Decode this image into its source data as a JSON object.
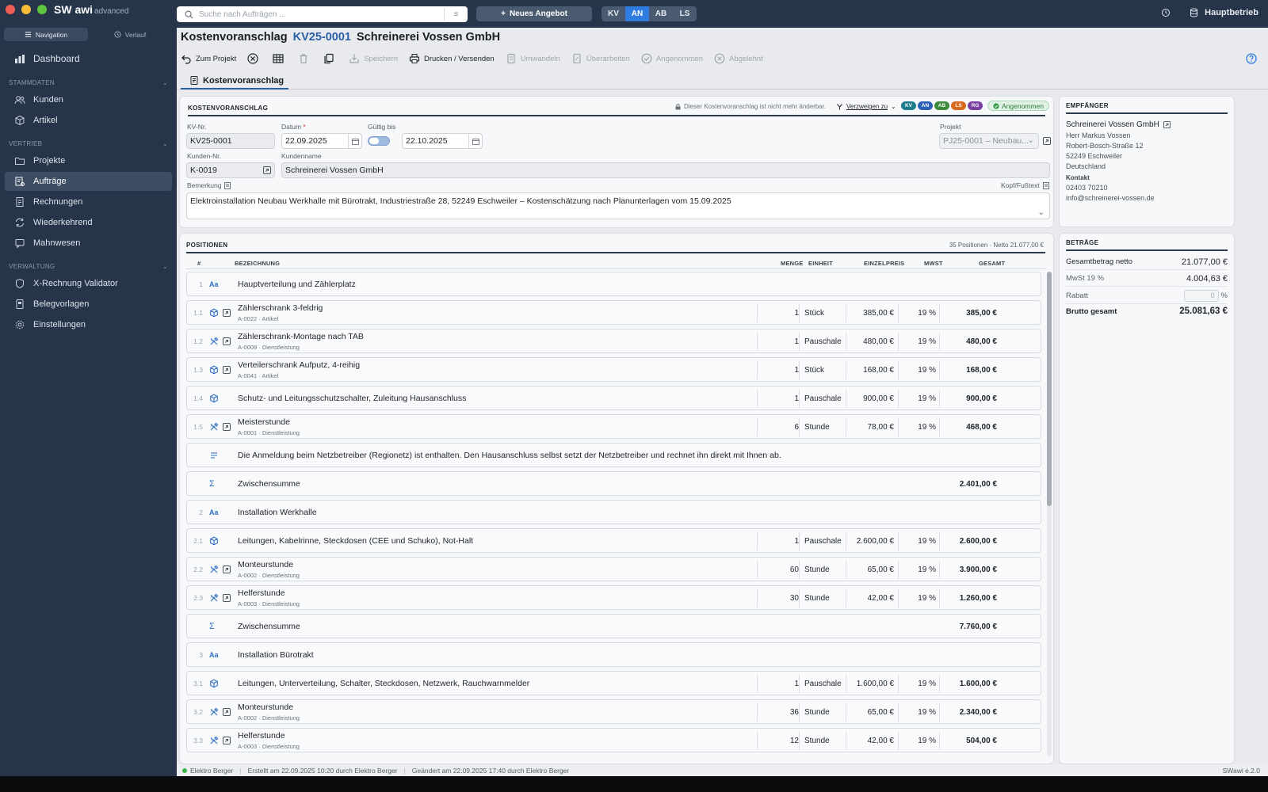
{
  "app": {
    "brand": "SW awi",
    "edition": "advanced",
    "version": "SWawi e.2.0"
  },
  "sidebar": {
    "tabs": [
      {
        "label": "Navigation"
      },
      {
        "label": "Verlauf"
      }
    ],
    "dashboard": "Dashboard",
    "sections": [
      {
        "title": "STAMMDATEN",
        "items": [
          {
            "label": "Kunden",
            "icon": "users-icon"
          },
          {
            "label": "Artikel",
            "icon": "box-icon"
          }
        ]
      },
      {
        "title": "VERTRIEB",
        "items": [
          {
            "label": "Projekte",
            "icon": "folder-icon"
          },
          {
            "label": "Aufträge",
            "icon": "orders-icon"
          },
          {
            "label": "Rechnungen",
            "icon": "invoice-icon"
          },
          {
            "label": "Wiederkehrend",
            "icon": "recurring-icon"
          },
          {
            "label": "Mahnwesen",
            "icon": "dunning-icon"
          }
        ]
      },
      {
        "title": "VERWALTUNG",
        "items": [
          {
            "label": "X-Rechnung Validator",
            "icon": "xinvoice-icon"
          },
          {
            "label": "Belegvorlagen",
            "icon": "template-icon"
          },
          {
            "label": "Einstellungen",
            "icon": "gear-icon"
          }
        ]
      }
    ]
  },
  "topbar": {
    "search_placeholder": "Suche nach Aufträgen ...",
    "new_button": "Neues Angebot",
    "doc_types": [
      "KV",
      "AN",
      "AB",
      "LS"
    ],
    "company": "Hauptbetrieb"
  },
  "header": {
    "title": "Kostenvoranschlag",
    "number": "KV25-0001",
    "customer": "Schreinerei Vossen GmbH"
  },
  "toolbar": {
    "back": "Zum Projekt",
    "save": "Speichern",
    "print": "Drucken / Versenden",
    "convert": "Umwandeln",
    "revise": "Überarbeiten",
    "accepted": "Angenommen",
    "rejected": "Abgelehnt"
  },
  "tab": "Kostenvoranschlag",
  "form": {
    "section": "KOSTENVORANSCHLAG",
    "lock_text": "Dieser Kostenvoranschlag ist nicht mehr änderbar.",
    "branch": "Verzweigen zu",
    "doc_pills": [
      {
        "label": "KV",
        "color": "#1d7c8c"
      },
      {
        "label": "AN",
        "color": "#2c62b4"
      },
      {
        "label": "AB",
        "color": "#3c8a3c"
      },
      {
        "label": "LS",
        "color": "#d9691c"
      },
      {
        "label": "RG",
        "color": "#7a3fa0"
      }
    ],
    "status": "Angenommen",
    "kv_label": "KV-Nr.",
    "kv_value": "KV25-0001",
    "date_label": "Datum",
    "date_value": "22.09.2025",
    "valid_label": "Gültig bis",
    "valid_value": "22.10.2025",
    "project_label": "Projekt",
    "project_value": "PJ25-0001 – Neubau...",
    "cust_no_label": "Kunden-Nr.",
    "cust_no_value": "K-0019",
    "cust_name_label": "Kundenname",
    "cust_name_value": "Schreinerei Vossen GmbH",
    "remark_label": "Bemerkung",
    "header_footer": "Kopf/Fußtext",
    "remark_value": "Elektroinstallation Neubau Werkhalle mit Bürotrakt, Industriestraße 28, 52249 Eschweiler – Kostenschätzung nach Planunterlagen vom 15.09.2025"
  },
  "positions": {
    "section": "POSITIONEN",
    "summary": "35 Positionen · Netto 21.077,00 €",
    "columns": [
      "#",
      "BEZEICHNUNG",
      "MENGE",
      "EINHEIT",
      "EINZELPREIS",
      "MWST",
      "GESAMT"
    ],
    "rows": [
      {
        "no": "1",
        "kind": "heading",
        "title": "Hauptverteilung und Zählerplatz"
      },
      {
        "no": "1.1",
        "kind": "article",
        "title": "Zählerschrank 3-feldrig",
        "sub": "A-0022 · Artikel",
        "qty": "1",
        "unit": "Stück",
        "price": "385,00 €",
        "vat": "19 %",
        "total": "385,00 €"
      },
      {
        "no": "1.2",
        "kind": "service",
        "title": "Zählerschrank-Montage nach TAB",
        "sub": "A-0009 · Dienstleistung",
        "qty": "1",
        "unit": "Pauschale",
        "price": "480,00 €",
        "vat": "19 %",
        "total": "480,00 €"
      },
      {
        "no": "1.3",
        "kind": "article",
        "title": "Verteilerschrank Aufputz, 4-reihig",
        "sub": "A-0041 · Artikel",
        "qty": "1",
        "unit": "Stück",
        "price": "168,00 €",
        "vat": "19 %",
        "total": "168,00 €"
      },
      {
        "no": "1.4",
        "kind": "free",
        "title": "Schutz- und Leitungsschutzschalter, Zuleitung Hausanschluss",
        "qty": "1",
        "unit": "Pauschale",
        "price": "900,00 €",
        "vat": "19 %",
        "total": "900,00 €"
      },
      {
        "no": "1.5",
        "kind": "service",
        "title": "Meisterstunde",
        "sub": "A-0001 · Dienstleistung",
        "qty": "6",
        "unit": "Stunde",
        "price": "78,00 €",
        "vat": "19 %",
        "total": "468,00 €"
      },
      {
        "no": "",
        "kind": "text",
        "title": "Die Anmeldung beim Netzbetreiber (Regionetz) ist enthalten. Den Hausanschluss selbst setzt der Netzbetreiber und rechnet ihn direkt mit Ihnen ab."
      },
      {
        "no": "",
        "kind": "subtotal",
        "title": "Zwischensumme",
        "total": "2.401,00 €"
      },
      {
        "no": "2",
        "kind": "heading",
        "title": "Installation Werkhalle"
      },
      {
        "no": "2.1",
        "kind": "free",
        "title": "Leitungen, Kabelrinne, Steckdosen (CEE und Schuko), Not-Halt",
        "qty": "1",
        "unit": "Pauschale",
        "price": "2.600,00 €",
        "vat": "19 %",
        "total": "2.600,00 €"
      },
      {
        "no": "2.2",
        "kind": "service",
        "title": "Monteurstunde",
        "sub": "A-0002 · Dienstleistung",
        "qty": "60",
        "unit": "Stunde",
        "price": "65,00 €",
        "vat": "19 %",
        "total": "3.900,00 €"
      },
      {
        "no": "2.3",
        "kind": "service",
        "title": "Helferstunde",
        "sub": "A-0003 · Dienstleistung",
        "qty": "30",
        "unit": "Stunde",
        "price": "42,00 €",
        "vat": "19 %",
        "total": "1.260,00 €"
      },
      {
        "no": "",
        "kind": "subtotal",
        "title": "Zwischensumme",
        "total": "7.760,00 €"
      },
      {
        "no": "3",
        "kind": "heading",
        "title": "Installation Bürotrakt"
      },
      {
        "no": "3.1",
        "kind": "free",
        "title": "Leitungen, Unterverteilung, Schalter, Steckdosen, Netzwerk, Rauchwarnmelder",
        "qty": "1",
        "unit": "Pauschale",
        "price": "1.600,00 €",
        "vat": "19 %",
        "total": "1.600,00 €"
      },
      {
        "no": "3.2",
        "kind": "service",
        "title": "Monteurstunde",
        "sub": "A-0002 · Dienstleistung",
        "qty": "36",
        "unit": "Stunde",
        "price": "65,00 €",
        "vat": "19 %",
        "total": "2.340,00 €"
      },
      {
        "no": "3.3",
        "kind": "service",
        "title": "Helferstunde",
        "sub": "A-0003 · Dienstleistung",
        "qty": "12",
        "unit": "Stunde",
        "price": "42,00 €",
        "vat": "19 %",
        "total": "504,00 €"
      }
    ]
  },
  "recipient": {
    "section": "EMPFÄNGER",
    "company": "Schreinerei Vossen GmbH",
    "person": "Herr Markus Vossen",
    "street": "Robert-Bosch-Straße 12",
    "city": "52249 Eschweiler",
    "country": "Deutschland",
    "contact_label": "Kontakt",
    "phone": "02403 70210",
    "email": "info@schreinerei-vossen.de"
  },
  "amounts": {
    "section": "BETRÄGE",
    "net_label": "Gesamtbetrag netto",
    "net": "21.077,00 €",
    "vat_label": "MwSt 19 %",
    "vat": "4.004,63 €",
    "discount_label": "Rabatt",
    "discount_value": "0",
    "discount_unit": "%",
    "gross_label": "Brutto gesamt",
    "gross": "25.081,63 €"
  },
  "statusbar": {
    "user": "Elektro Berger",
    "created": "Erstellt am 22.09.2025 10:20 durch Elektro Berger",
    "changed": "Geändert am 22.09.2025 17:40 durch Elektro Berger"
  }
}
